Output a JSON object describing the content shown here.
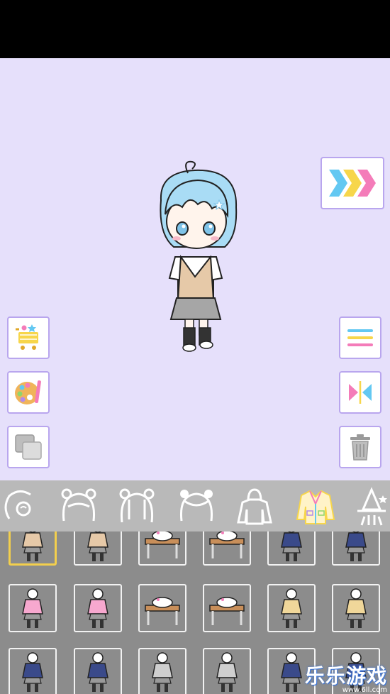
{
  "app": {
    "colors": {
      "stage_bg": "#e6e0fb",
      "button_border": "#b9a6ee",
      "category_bar": "#b9b9b9",
      "item_grid_bg": "#8c8c8c",
      "selected_border": "#f3cf4d"
    }
  },
  "stage": {
    "character_icon": "chibi-girl-school-uniform",
    "left_buttons": [
      "shop-cart-icon",
      "palette-icon",
      "layers-icon"
    ],
    "right_buttons": [
      "menu-icon",
      "flip-icon",
      "trash-icon"
    ],
    "next_button_icon": "triple-chevron-icon"
  },
  "categories": [
    {
      "icon": "face-icon"
    },
    {
      "icon": "front-hair-icon"
    },
    {
      "icon": "back-hair-icon"
    },
    {
      "icon": "side-hair-icon"
    },
    {
      "icon": "hoodie-icon"
    },
    {
      "icon": "jacket-icon",
      "selected": true
    },
    {
      "icon": "witch-hat-icon"
    }
  ],
  "items": {
    "rows": 3,
    "cols": 6,
    "selected_index": 0,
    "thumbnails": [
      "standing-girl-pose",
      "standing-back-pose",
      "desk-scene",
      "desk-scene",
      "blazer-pose",
      "blazer-pose",
      "pink-sweater-pose",
      "pink-sweater-pose",
      "desk-sleep-scene",
      "desk-sleep-scene",
      "dancing-pose",
      "dancing-pose",
      "sailor-uniform-pose",
      "sailor-uniform-pose",
      "grey-hoodie-pose",
      "grey-hoodie-pose",
      "falling-pose",
      "falling-pose"
    ]
  },
  "watermark": {
    "title": "乐乐游戏",
    "url": "www.6ll.com"
  }
}
